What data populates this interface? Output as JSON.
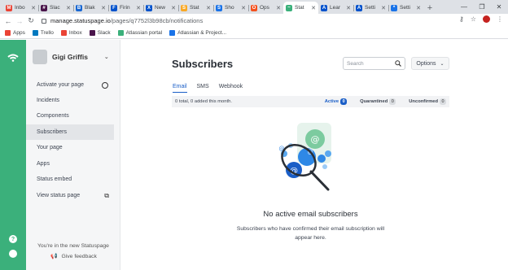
{
  "browser": {
    "tabs": [
      {
        "label": "Inbo",
        "color": "#ea4335",
        "glyph": "M"
      },
      {
        "label": "Slac",
        "color": "#4a154b",
        "glyph": "#"
      },
      {
        "label": "Blak",
        "color": "#1967d2",
        "glyph": "B"
      },
      {
        "label": "Firin",
        "color": "#0052cc",
        "glyph": "F"
      },
      {
        "label": "New",
        "color": "#0052cc",
        "glyph": "X"
      },
      {
        "label": "Stat",
        "color": "#f9a825",
        "glyph": "S"
      },
      {
        "label": "Sho",
        "color": "#1a73e8",
        "glyph": "S"
      },
      {
        "label": "Ops",
        "color": "#f4511e",
        "glyph": "O"
      },
      {
        "label": "Stat",
        "color": "#3bb07b",
        "glyph": "~"
      },
      {
        "label": "Lear",
        "color": "#0052cc",
        "glyph": "A"
      },
      {
        "label": "Setti",
        "color": "#0052cc",
        "glyph": "A"
      },
      {
        "label": "Setti",
        "color": "#1a73e8",
        "glyph": "*"
      }
    ],
    "active_tab_index": 8,
    "url_host": "manage.statuspage.io",
    "url_path": "/pages/q7752l3b98cb/notifications",
    "bookmarks": [
      {
        "label": "Apps",
        "color": "#ea4335"
      },
      {
        "label": "Trello",
        "color": "#0079bf"
      },
      {
        "label": "Inbox",
        "color": "#ea4335"
      },
      {
        "label": "Slack",
        "color": "#4a154b"
      },
      {
        "label": "Atlassian portal",
        "color": "#3bb07b"
      },
      {
        "label": "Atlassian & Project...",
        "color": "#1a73e8"
      }
    ]
  },
  "sidebar": {
    "user_name": "Gigi Griffis",
    "items": [
      {
        "label": "Activate your page"
      },
      {
        "label": "Incidents"
      },
      {
        "label": "Components"
      },
      {
        "label": "Subscribers"
      },
      {
        "label": "Your page"
      },
      {
        "label": "Apps"
      },
      {
        "label": "Status embed"
      },
      {
        "label": "View status page"
      }
    ],
    "footer": "You're in the new Statuspage",
    "feedback": "Give feedback"
  },
  "main": {
    "title": "Subscribers",
    "search_placeholder": "Search",
    "options_label": "Options",
    "tabs": [
      "Email",
      "SMS",
      "Webhook"
    ],
    "summary": "0 total, 0 added this month.",
    "stats": [
      {
        "label": "Active",
        "count": "0"
      },
      {
        "label": "Quarantined",
        "count": "0"
      },
      {
        "label": "Unconfirmed",
        "count": "0"
      }
    ],
    "empty_title": "No active email subscribers",
    "empty_text": "Subscribers who have confirmed their email subscription will appear here."
  },
  "colors": {
    "brand": "#3bb07b",
    "accent": "#1a5ec7"
  }
}
